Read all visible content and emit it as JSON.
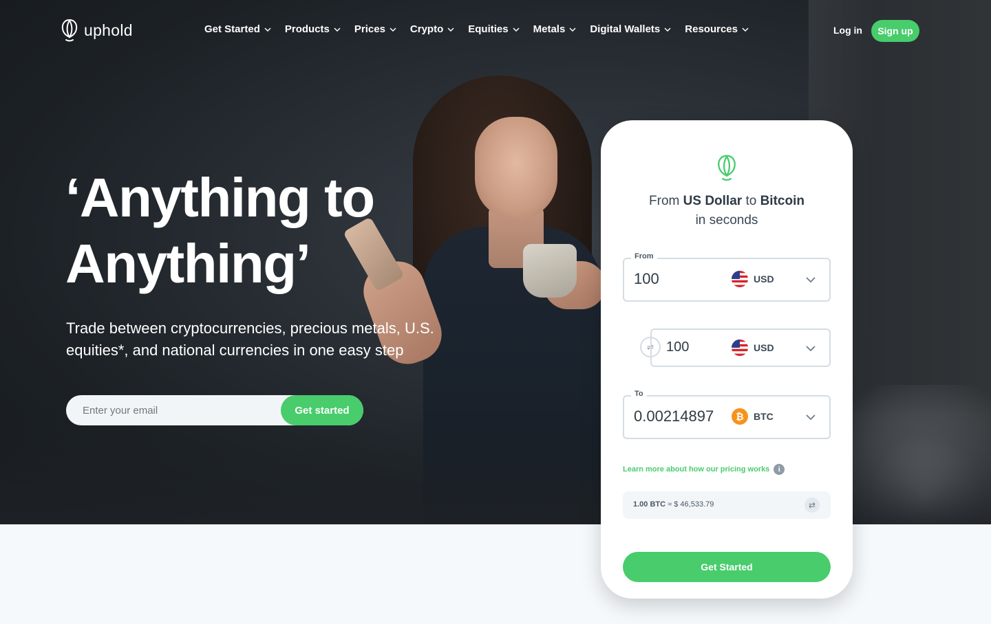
{
  "brand": {
    "name": "uphold",
    "accent": "#48cc6c"
  },
  "nav": {
    "items": [
      {
        "label": "Get Started"
      },
      {
        "label": "Products"
      },
      {
        "label": "Prices"
      },
      {
        "label": "Crypto"
      },
      {
        "label": "Equities"
      },
      {
        "label": "Metals"
      },
      {
        "label": "Digital Wallets"
      },
      {
        "label": "Resources"
      }
    ],
    "login": "Log in",
    "signup": "Sign up"
  },
  "hero": {
    "headline_1": "‘Anything to",
    "headline_2": "Anything’",
    "subline": "Trade between cryptocurrencies, precious metals, U.S. equities*, and national currencies in one easy step",
    "email_placeholder": "Enter your email",
    "cta": "Get started"
  },
  "widget": {
    "title_prefix": "From ",
    "title_from": "US Dollar",
    "title_mid": " to ",
    "title_to": "Bitcoin",
    "title_suffix": "in seconds",
    "from": {
      "label": "From",
      "value": "100",
      "currency": "USD"
    },
    "middle": {
      "value": "100",
      "currency": "USD"
    },
    "to": {
      "label": "To",
      "value": "0.00214897",
      "currency": "BTC"
    },
    "learn_more": "Learn more about how our pricing works",
    "rate": {
      "left": "1.00 BTC",
      "approx": "≈",
      "right": "$ 46,533.79"
    },
    "cta": "Get Started"
  }
}
